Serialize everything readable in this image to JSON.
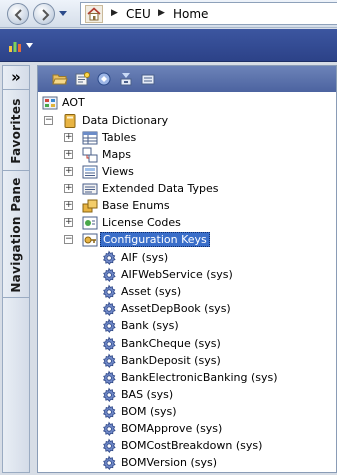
{
  "breadcrumb": {
    "items": [
      "CEU",
      "Home"
    ]
  },
  "side_panel": {
    "collapse_label": "»",
    "tabs": [
      "Favorites",
      "Navigation Pane"
    ]
  },
  "aot": {
    "root_label": "AOT",
    "data_dictionary": {
      "label": "Data Dictionary",
      "children": [
        {
          "label": "Tables",
          "icon": "tables-icon"
        },
        {
          "label": "Maps",
          "icon": "maps-icon"
        },
        {
          "label": "Views",
          "icon": "views-icon"
        },
        {
          "label": "Extended Data Types",
          "icon": "extended-data-types-icon"
        },
        {
          "label": "Base Enums",
          "icon": "base-enums-icon"
        },
        {
          "label": "License Codes",
          "icon": "license-codes-icon"
        },
        {
          "label": "Configuration Keys",
          "icon": "configuration-keys-icon",
          "selected": true
        }
      ]
    },
    "configuration_keys": [
      "AIF (sys)",
      "AIFWebService (sys)",
      "Asset (sys)",
      "AssetDepBook (sys)",
      "Bank (sys)",
      "BankCheque (sys)",
      "BankDeposit (sys)",
      "BankElectronicBanking (sys)",
      "BAS (sys)",
      "BOM (sys)",
      "BOMApprove (sys)",
      "BOMCostBreakdown (sys)",
      "BOMVersion (sys)"
    ]
  },
  "colors": {
    "toolbar": "#2c4288",
    "selection": "#3a6ec9",
    "folder": "#e8b443"
  }
}
